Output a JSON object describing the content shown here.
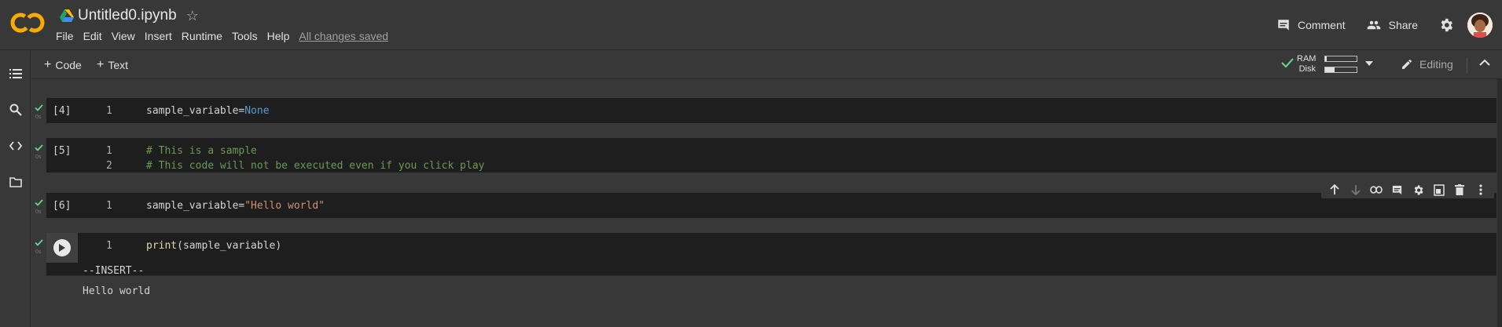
{
  "header": {
    "doc_title": "Untitled0.ipynb",
    "menu": [
      "File",
      "Edit",
      "View",
      "Insert",
      "Runtime",
      "Tools",
      "Help"
    ],
    "save_status": "All changes saved",
    "comment_label": "Comment",
    "share_label": "Share"
  },
  "toolbar": {
    "add_code_label": "Code",
    "add_text_label": "Text",
    "ram_label": "RAM",
    "disk_label": "Disk",
    "ram_usage": 0.05,
    "disk_usage": 0.3,
    "editing_label": "Editing"
  },
  "cells": [
    {
      "exec_count": "[4]",
      "time": "0s",
      "lines": [
        {
          "no": "1",
          "code": "sample_variable=None"
        }
      ]
    },
    {
      "exec_count": "[5]",
      "time": "0s",
      "lines": [
        {
          "no": "1",
          "code": "# This is a sample"
        },
        {
          "no": "2",
          "code": "# This code will not be executed even if you click play"
        }
      ]
    },
    {
      "exec_count": "[6]",
      "time": "0s",
      "lines": [
        {
          "no": "1",
          "code": "sample_variable=\"Hello world\""
        }
      ]
    },
    {
      "exec_count": "",
      "time": "0s",
      "lines": [
        {
          "no": "1",
          "code": "print(sample_variable)"
        }
      ],
      "mode": "--INSERT--",
      "output": "Hello world"
    }
  ],
  "colors": {
    "background": "#383838",
    "cell_bg": "#1e1e1e",
    "success_check": "#6dd58c",
    "keyword": "#569cd6",
    "string": "#ce9178",
    "comment": "#6a9955",
    "function": "#dcdcaa"
  },
  "icons": {
    "logo": "colab-logo",
    "rail": [
      "table-of-contents-icon",
      "search-icon",
      "code-snippets-icon",
      "files-icon"
    ],
    "cell_toolbar": [
      "move-up-icon",
      "move-down-icon",
      "link-icon",
      "comment-icon",
      "settings-icon",
      "mirror-cell-icon",
      "delete-icon",
      "more-icon"
    ]
  }
}
